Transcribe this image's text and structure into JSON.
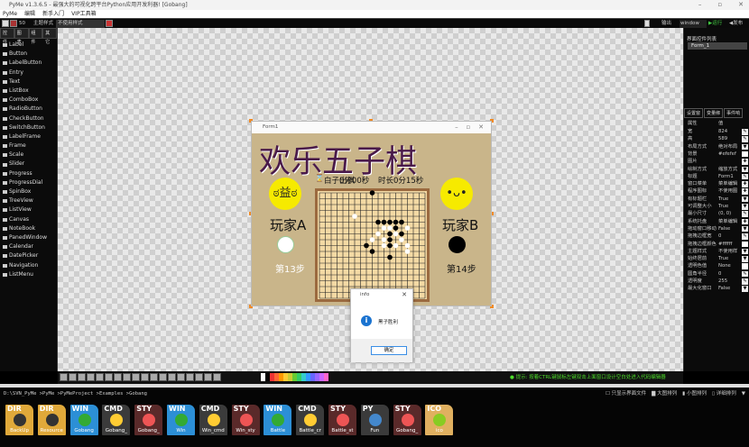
{
  "app": {
    "title": "PyMe v1.3.6.5 - 最强大的可视化跨平台Python应用开发利器!   [Gobang]"
  },
  "menu": [
    "PyMe",
    "编辑",
    "新手入门",
    "VIP工具箱"
  ],
  "toolbar": {
    "zoom": "50",
    "theme_label": "主题样式",
    "theme_value": "不使用样式",
    "output": "输出",
    "target": "window",
    "run": "▶运行",
    "publish": "◀发布"
  },
  "left_tabs": [
    "控件",
    "图表",
    "组件",
    "其它"
  ],
  "widgets": [
    "Label",
    "Button",
    "LabelButton",
    "Entry",
    "Text",
    "ListBox",
    "ComboBox",
    "RadioButton",
    "CheckButton",
    "SwitchButton",
    "LabelFrame",
    "Frame",
    "Scale",
    "Slider",
    "Progress",
    "ProgressDial",
    "SpinBox",
    "TreeView",
    "ListView",
    "Canvas",
    "NoteBook",
    "PanedWindow",
    "Calendar",
    "DatePicker",
    "Navigation",
    "ListMenu"
  ],
  "right": {
    "list_title": "界面控件列表",
    "list_items": [
      "Form_1"
    ],
    "tabs": [
      "设置窗",
      "变量绑",
      "事件响"
    ],
    "head_key": "属性",
    "head_val": "值",
    "props": [
      [
        "宽",
        "824",
        "e"
      ],
      [
        "高",
        "589",
        "e"
      ],
      [
        "布局方式",
        "绝对布局",
        "d"
      ],
      [
        "背景",
        "#efefef",
        ""
      ],
      [
        "图片",
        "",
        "p"
      ],
      [
        "绘制方式",
        "缩放方式",
        "d"
      ],
      [
        "标题",
        "Form1",
        "e"
      ],
      [
        "窗口菜单",
        "菜单编辑",
        "p"
      ],
      [
        "程序图标",
        "不使用图",
        "p"
      ],
      [
        "有标题栏",
        "True",
        "d"
      ],
      [
        "可调整大小",
        "True",
        "d"
      ],
      [
        "最小尺寸",
        "(0, 0)",
        "e"
      ],
      [
        "系统托盘",
        "菜单编辑",
        "p"
      ],
      [
        "拖动窗口移动",
        "False",
        "d"
      ],
      [
        "拖拽边框宽",
        "0",
        "e"
      ],
      [
        "拖拽边框颜色",
        "#ffffff",
        ""
      ],
      [
        "主题样式",
        "不使用样",
        "d"
      ],
      [
        "始终居前",
        "True",
        "d"
      ],
      [
        "透明色值",
        "None",
        ""
      ],
      [
        "圆角半径",
        "0",
        "e"
      ],
      [
        "透明度",
        "255",
        "e"
      ],
      [
        "最大化窗口",
        "False",
        "d"
      ]
    ]
  },
  "form": {
    "title": "Form1",
    "heading": "欢乐五子棋",
    "timer_a": "白子出棋",
    "timer_b": "0分00秒",
    "timer_c": "时长0分15秒",
    "player_a": "玩家A",
    "player_b": "玩家B",
    "step_a": "第13步",
    "step_b": "第14步",
    "black": [
      [
        9,
        0
      ],
      [
        10,
        5
      ],
      [
        11,
        5
      ],
      [
        12,
        5
      ],
      [
        13,
        5
      ],
      [
        14,
        5
      ],
      [
        13,
        6
      ],
      [
        12,
        7
      ],
      [
        14,
        7
      ],
      [
        12,
        8
      ],
      [
        8,
        9
      ],
      [
        12,
        9
      ],
      [
        9,
        10
      ],
      [
        12,
        11
      ]
    ],
    "white": [
      [
        6,
        4
      ],
      [
        11,
        6
      ],
      [
        12,
        6
      ],
      [
        15,
        6
      ],
      [
        10,
        7
      ],
      [
        9,
        8
      ],
      [
        11,
        8
      ],
      [
        14,
        8
      ],
      [
        11,
        9
      ],
      [
        13,
        9
      ],
      [
        15,
        9
      ],
      [
        15,
        10
      ],
      [
        13,
        7
      ]
    ],
    "colors": {
      "heading": "#4a1a4a",
      "bg": "#c9b58a",
      "board": "#f3d9a4",
      "frame": "#9b6a3f"
    }
  },
  "dialog": {
    "title": "info",
    "message": "黑子胜利",
    "ok": "确定"
  },
  "hint": "提示: 按着CTRL键鼠标左键双击上面窗口设计空白处进入代码编辑器",
  "path": "D:\\SVN_PyMe >PyMe >PyMeProject >Examples >Gobang",
  "view_options": [
    "只显示界面文件",
    "大图排列",
    "小图排列",
    "详细排列"
  ],
  "files": [
    {
      "type": "DIR",
      "name": "BackUp",
      "color": "#e0a93a"
    },
    {
      "type": "DIR",
      "name": "Resource",
      "color": "#e0a93a"
    },
    {
      "type": "WIN",
      "name": "Gobang",
      "color": "#2c8fd6"
    },
    {
      "type": "CMD",
      "name": "Gobang_",
      "color": "#3b3b3b"
    },
    {
      "type": "STY",
      "name": "Gobang_",
      "color": "#5a2a2a"
    },
    {
      "type": "WIN",
      "name": "Win",
      "color": "#2c8fd6"
    },
    {
      "type": "CMD",
      "name": "Win_cmd",
      "color": "#3b3b3b"
    },
    {
      "type": "STY",
      "name": "Win_sty",
      "color": "#5a2a2a"
    },
    {
      "type": "WIN",
      "name": "Battle",
      "color": "#2c8fd6"
    },
    {
      "type": "CMD",
      "name": "Battle_cr",
      "color": "#3b3b3b"
    },
    {
      "type": "STY",
      "name": "Battle_st",
      "color": "#5a2a2a"
    },
    {
      "type": "PY",
      "name": "Fun",
      "color": "#3b3b3b"
    },
    {
      "type": "STY",
      "name": "Gobang_",
      "color": "#5a2a2a"
    },
    {
      "type": "ICO",
      "name": "ico",
      "color": "#e0b060"
    }
  ]
}
